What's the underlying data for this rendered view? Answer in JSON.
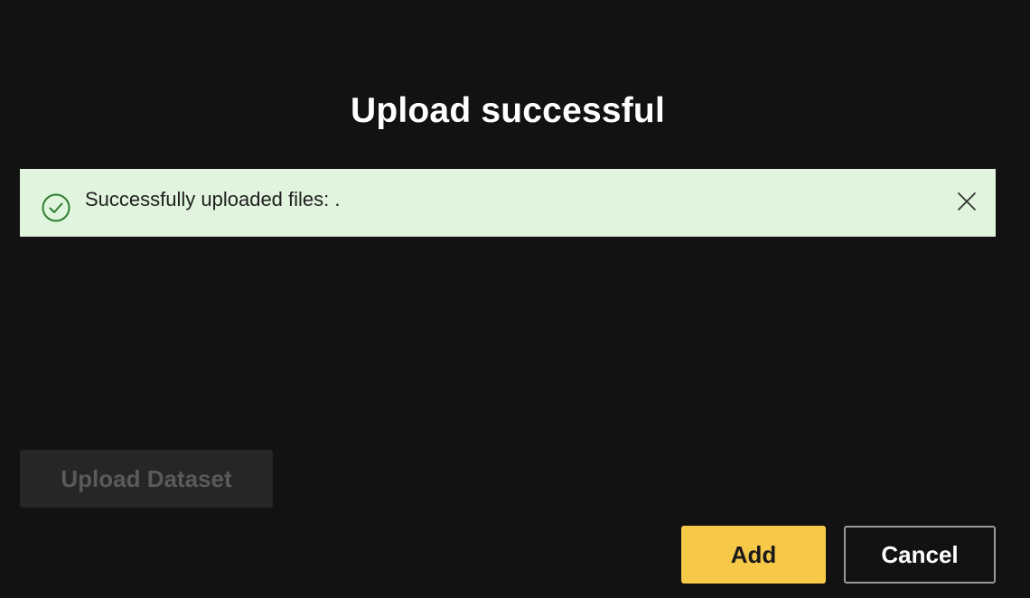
{
  "dialog": {
    "title": "Upload successful"
  },
  "alert": {
    "message": "Successfully uploaded files: .",
    "status_icon": "check-circle-icon",
    "close_icon": "close-icon",
    "background_color": "#e1f5de",
    "icon_color": "#2e7d32"
  },
  "upload": {
    "label": "Upload Dataset",
    "disabled": true
  },
  "actions": {
    "add_label": "Add",
    "cancel_label": "Cancel",
    "accent_color": "#f7c948"
  }
}
